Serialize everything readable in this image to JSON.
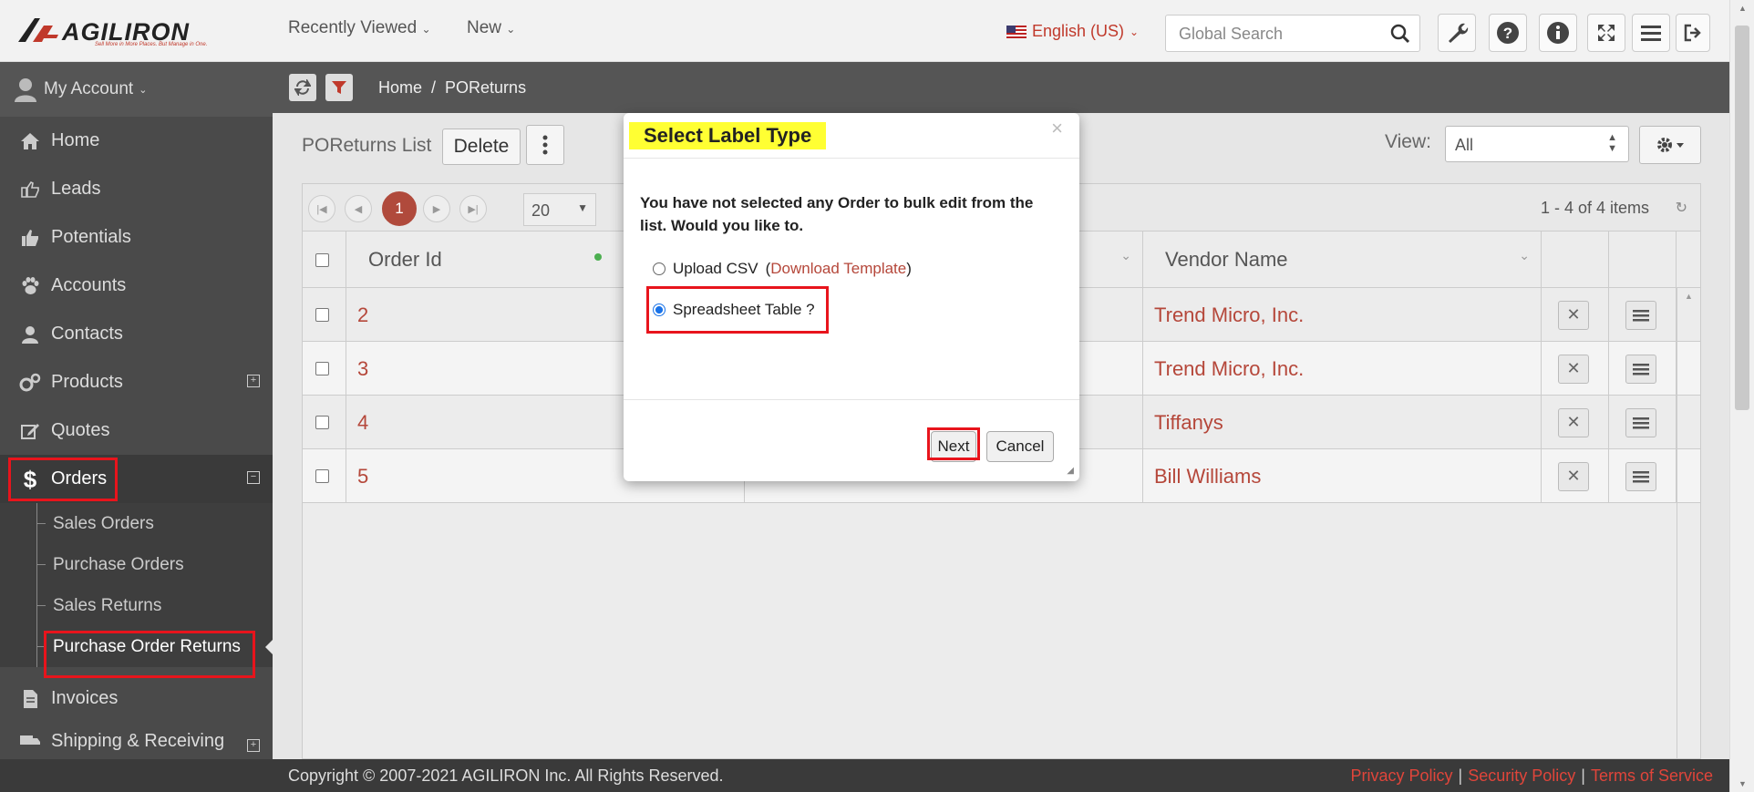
{
  "brand": {
    "name": "AGILIRON",
    "tagline": "Sell More in More Places. But Manage in One."
  },
  "topnav": {
    "recently_viewed": "Recently Viewed",
    "new": "New"
  },
  "language": "English (US)",
  "search": {
    "placeholder": "Global Search"
  },
  "sidebar": {
    "account": "My Account",
    "items": [
      {
        "label": "Home",
        "icon": "home-icon"
      },
      {
        "label": "Leads",
        "icon": "thumb-point-icon"
      },
      {
        "label": "Potentials",
        "icon": "thumbs-up-icon"
      },
      {
        "label": "Accounts",
        "icon": "paw-icon"
      },
      {
        "label": "Contacts",
        "icon": "user-icon"
      },
      {
        "label": "Products",
        "icon": "gears-icon"
      },
      {
        "label": "Quotes",
        "icon": "edit-icon"
      },
      {
        "label": "Orders",
        "icon": "dollar-icon"
      },
      {
        "label": "Invoices",
        "icon": "file-icon"
      },
      {
        "label": "Shipping & Receiving",
        "icon": "truck-icon"
      }
    ],
    "sub_items": [
      "Sales Orders",
      "Purchase Orders",
      "Sales Returns",
      "Purchase Order Returns"
    ]
  },
  "breadcrumb": {
    "home": "Home",
    "sep": "/",
    "current": "POReturns"
  },
  "list": {
    "title": "POReturns List",
    "delete_label": "Delete",
    "view_label": "View:",
    "view_value": "All",
    "pager": {
      "page": "1",
      "page_size": "20",
      "info": "1 - 4 of 4 items"
    },
    "columns": {
      "order_id": "Order Id",
      "vendor_name": "Vendor Name"
    },
    "rows": [
      {
        "id": "2",
        "vendor": "Trend Micro, Inc."
      },
      {
        "id": "3",
        "vendor": "Trend Micro, Inc."
      },
      {
        "id": "4",
        "vendor": "Tiffanys"
      },
      {
        "id": "5",
        "vendor": "Bill Williams"
      }
    ]
  },
  "modal": {
    "title": "Select Label Type",
    "close": "×",
    "message": "You have not selected any Order to bulk edit from the list. Would you like to.",
    "option_upload": "Upload CSV",
    "download_template": "Download Template",
    "option_spreadsheet": "Spreadsheet Table ?",
    "next": "Next",
    "cancel": "Cancel"
  },
  "footer": {
    "copyright": "Copyright © 2007-2021 AGILIRON Inc. All Rights Reserved.",
    "privacy": "Privacy Policy",
    "security": "Security Policy",
    "terms": "Terms of Service",
    "sep": "|"
  },
  "colors": {
    "accent": "#b5473a",
    "highlight": "#ffff33",
    "annotation": "#e8141c"
  }
}
